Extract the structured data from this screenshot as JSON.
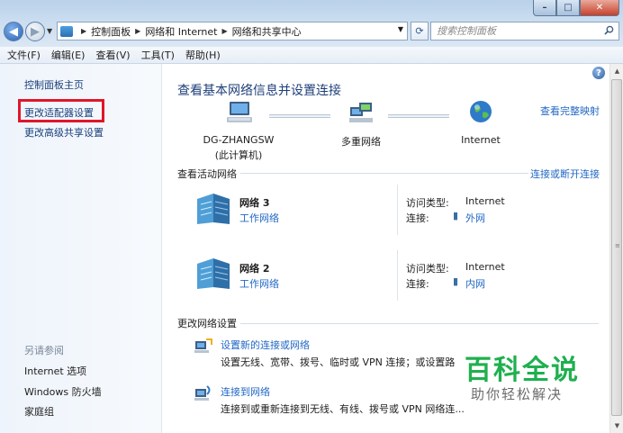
{
  "window": {
    "minimize_label": "–",
    "maximize_label": "□",
    "close_label": "✕"
  },
  "nav": {
    "back_glyph": "◀",
    "forward_glyph": "▶"
  },
  "address": {
    "crumbs": [
      "控制面板",
      "网络和 Internet",
      "网络和共享中心"
    ],
    "refresh_glyph": "⟳"
  },
  "search": {
    "placeholder": "搜索控制面板"
  },
  "menu": {
    "items": [
      "文件(F)",
      "编辑(E)",
      "查看(V)",
      "工具(T)",
      "帮助(H)"
    ]
  },
  "sidebar": {
    "home": "控制面板主页",
    "adapter": "更改适配器设置",
    "advanced": "更改高级共享设置",
    "see_also_heading": "另请参阅",
    "see_also": [
      "Internet 选项",
      "Windows 防火墙",
      "家庭组"
    ]
  },
  "main": {
    "help_glyph": "?",
    "title": "查看基本网络信息并设置连接",
    "view_full_map": "查看完整映射",
    "map": {
      "computer_name": "DG-ZHANGSW",
      "computer_sub": "(此计算机)",
      "middle_label": "多重网络",
      "internet_label": "Internet"
    },
    "active_section": {
      "heading": "查看活动网络",
      "action_link": "连接或断开连接"
    },
    "networks": [
      {
        "name": "网络  3",
        "type": "工作网络",
        "access_label": "访问类型:",
        "access_value": "Internet",
        "conn_label": "连接:",
        "conn_value": "外网"
      },
      {
        "name": "网络  2",
        "type": "工作网络",
        "access_label": "访问类型:",
        "access_value": "Internet",
        "conn_label": "连接:",
        "conn_value": "内网"
      }
    ],
    "change_section": {
      "heading": "更改网络设置"
    },
    "tasks": [
      {
        "title": "设置新的连接或网络",
        "desc": "设置无线、宽带、拨号、临时或 VPN 连接；或设置路"
      },
      {
        "title": "连接到网络",
        "desc": "连接到或重新连接到无线、有线、拨号或 VPN 网络连..."
      }
    ]
  },
  "watermark": {
    "title": "百科全说",
    "subtitle": "助你轻松解决"
  },
  "colors": {
    "link": "#2268c4",
    "highlight_box": "#e0162b",
    "watermark_green": "#1fb04f"
  }
}
